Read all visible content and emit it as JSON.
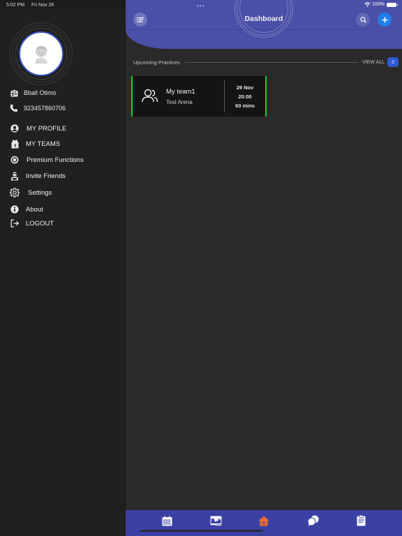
{
  "status_bar": {
    "time": "5:02 PM",
    "date": "Fri Nov 26",
    "battery": "100%"
  },
  "sidebar": {
    "user_name": "Bball Otimo",
    "phone": "923457860706",
    "items": [
      {
        "label": "MY PROFILE",
        "icon": "user-circle-icon"
      },
      {
        "label": "MY TEAMS",
        "icon": "jersey-icon"
      },
      {
        "label": "Premium Functions",
        "icon": "premium-badge-icon"
      },
      {
        "label": "Invite Friends",
        "icon": "invite-person-icon"
      },
      {
        "label": "Settings",
        "icon": "gear-icon"
      },
      {
        "label": "About",
        "icon": "info-icon"
      },
      {
        "label": "LOGOUT",
        "icon": "logout-icon"
      }
    ]
  },
  "header": {
    "title": "Dashboard",
    "multitask_dots": "•••"
  },
  "upcoming": {
    "title": "Upcoming Practices",
    "view_all": "VIEW ALL",
    "count": "3",
    "cards": [
      {
        "team": "My team1",
        "venue": "Test Arena",
        "date": "29 Nov",
        "time": "20:00",
        "duration": "60 mins"
      }
    ]
  },
  "tabbar": {
    "tabs": [
      {
        "name": "calendar",
        "active": false
      },
      {
        "name": "gallery",
        "active": false
      },
      {
        "name": "home",
        "active": true
      },
      {
        "name": "chat",
        "active": false
      },
      {
        "name": "clipboard",
        "active": false
      }
    ]
  },
  "colors": {
    "accent": "#4a4fa8",
    "tabbar": "#3b41a3",
    "active_tab": "#f26b2e",
    "card_border": "#1ecf2e",
    "badge": "#2e5bd1",
    "add_button": "#1e7fe8"
  }
}
